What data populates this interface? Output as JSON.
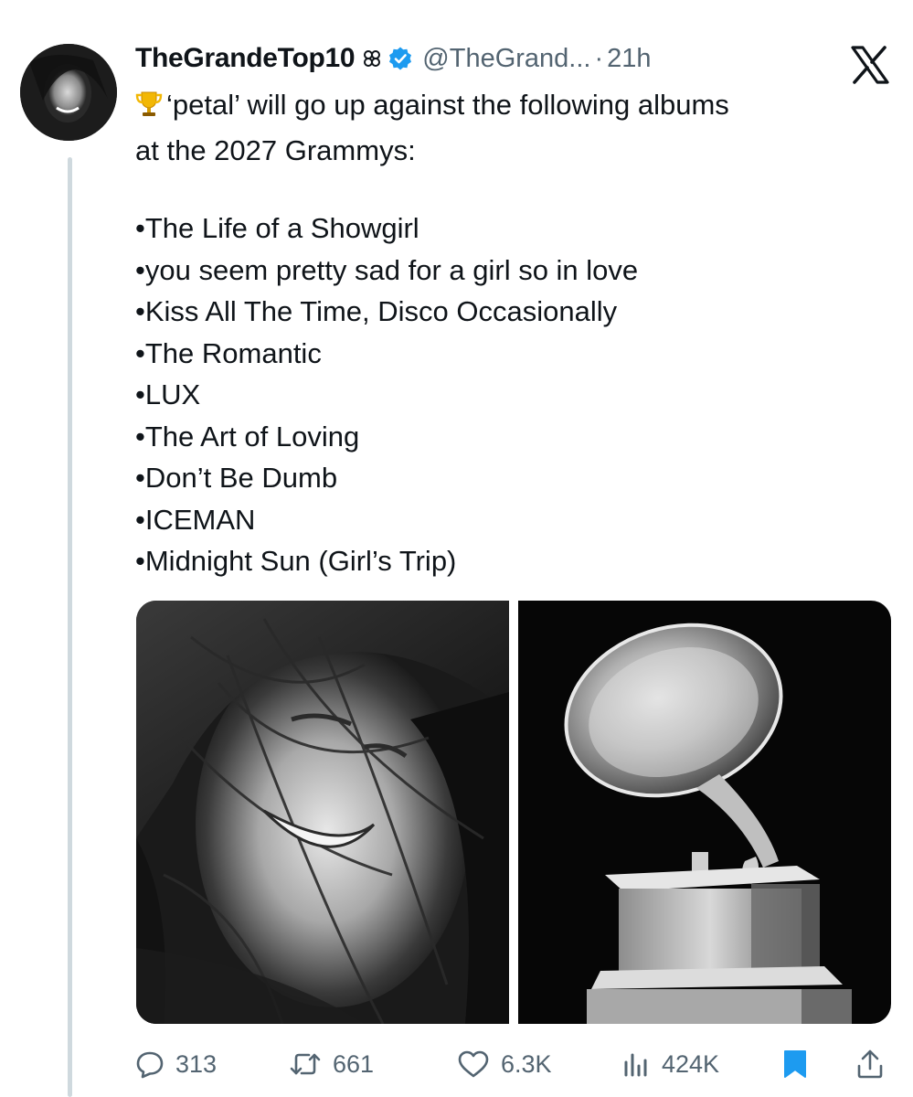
{
  "tweet": {
    "display_name": "TheGrandeTop10",
    "handle": "@TheGrand...",
    "separator": "·",
    "time": "21h",
    "text_line1": "‘petal’ will go up against the following albums",
    "text_line2": "at the 2027 Grammys:",
    "albums": [
      "•The Life of a Showgirl",
      "•you seem pretty sad for a girl so in love",
      "•Kiss All The Time, Disco Occasionally",
      "•The Romantic",
      "•LUX",
      "•The Art of Loving",
      "•Don’t Be Dumb",
      "•ICEMAN",
      "•Midnight Sun (Girl’s Trip)"
    ]
  },
  "media": {
    "images": [
      {
        "icon": "bw-portrait-photo"
      },
      {
        "icon": "grammy-gramophone-trophy-photo"
      }
    ]
  },
  "actions": {
    "replies": "313",
    "reposts": "661",
    "likes": "6.3K",
    "views": "424K"
  },
  "colors": {
    "text": "#0f1419",
    "secondary": "#536471",
    "verified": "#1d9bf0",
    "bookmark": "#1d9bf0",
    "thread_line": "#cfd9de"
  }
}
